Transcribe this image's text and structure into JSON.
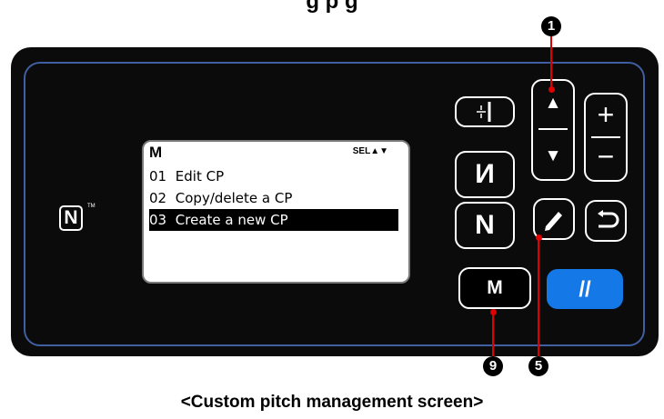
{
  "header": {
    "title_fragment": "g                                    p                g"
  },
  "screen": {
    "mode_label": "M",
    "sel_label": "SEL▲▼",
    "items": [
      {
        "num": "01",
        "label": "Edit CP"
      },
      {
        "num": "02",
        "label": "Copy/delete a CP"
      },
      {
        "num": "03",
        "label": "Create a new CP",
        "selected": true
      }
    ]
  },
  "buttons": {
    "m_label": "M",
    "reset_label": "//",
    "plus_label": "+",
    "minus_label": "−",
    "up_label": "▲",
    "down_label": "▼"
  },
  "callouts": {
    "one": "1",
    "five": "5",
    "nine": "9"
  },
  "caption": "<Custom pitch management screen>",
  "colors": {
    "panel": "#0b0b0b",
    "panel_border": "#3f5fa0",
    "accent_blue": "#1478e6",
    "callout_red": "#e00000"
  }
}
